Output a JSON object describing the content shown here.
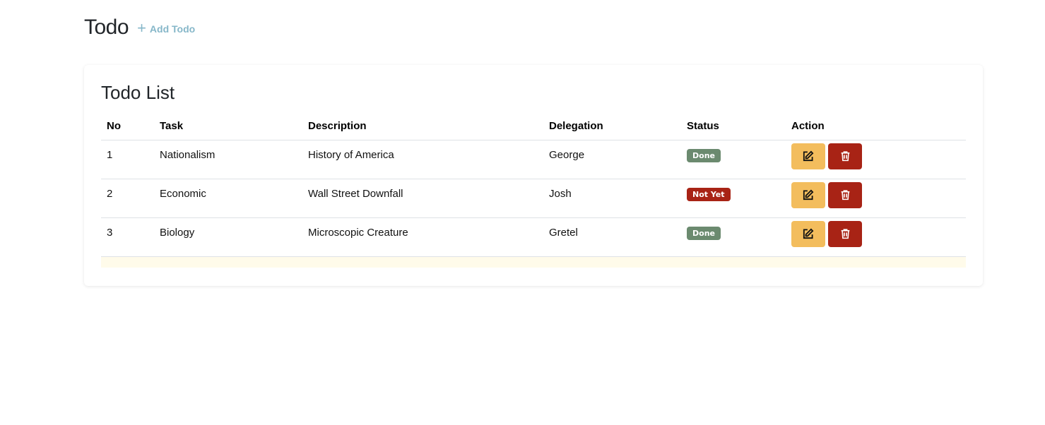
{
  "header": {
    "title": "Todo",
    "add_label": "Add Todo"
  },
  "card": {
    "title": "Todo List",
    "columns": [
      "No",
      "Task",
      "Description",
      "Delegation",
      "Status",
      "Action"
    ]
  },
  "rows": [
    {
      "no": "1",
      "task": "Nationalism",
      "description": "History of America",
      "delegation": "George",
      "status": "Done",
      "status_color": "#6b8a6f"
    },
    {
      "no": "2",
      "task": "Economic",
      "description": "Wall Street Downfall",
      "delegation": "Josh",
      "status": "Not Yet",
      "status_color": "#a82315"
    },
    {
      "no": "3",
      "task": "Biology",
      "description": "Microscopic Creature",
      "delegation": "Gretel",
      "status": "Done",
      "status_color": "#6b8a6f"
    }
  ],
  "icons": {
    "add": "plus-icon",
    "edit": "pencil-square-icon",
    "delete": "trash-icon"
  },
  "colors": {
    "edit_button": "#f3bd5d",
    "delete_button": "#a82315",
    "link": "#86b7c9"
  }
}
